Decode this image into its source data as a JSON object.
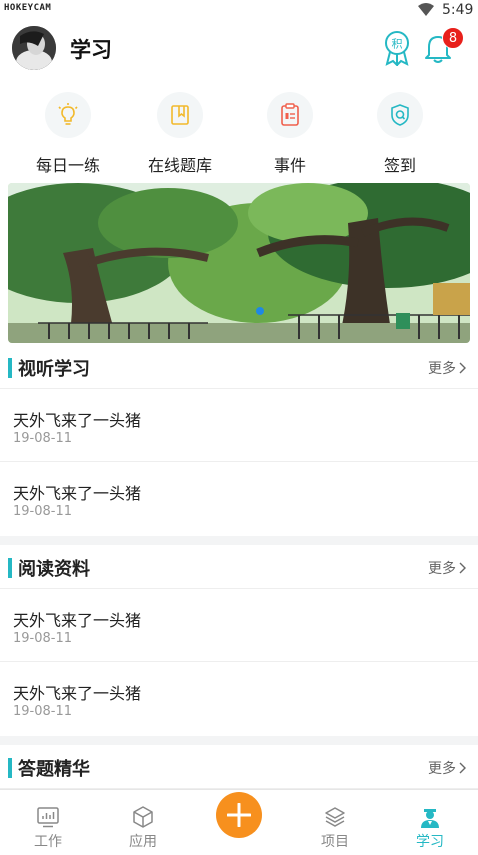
{
  "status_bar": {
    "watermark": "HOKEYCAM",
    "time": "5:49"
  },
  "header": {
    "title": "学习",
    "badge_char": "积",
    "notification_count": "8"
  },
  "quick_actions": [
    {
      "label": "每日一练",
      "icon": "lightbulb-icon",
      "color": "#f2b92b"
    },
    {
      "label": "在线题库",
      "icon": "bookmark-book-icon",
      "color": "#f2b92b"
    },
    {
      "label": "事件",
      "icon": "clipboard-icon",
      "color": "#f0604d"
    },
    {
      "label": "签到",
      "icon": "shield-check-icon",
      "color": "#25b8c4"
    }
  ],
  "sections": [
    {
      "title": "视听学习",
      "more": "更多",
      "items": [
        {
          "title": "天外飞来了一头猪",
          "date": "19-08-11"
        },
        {
          "title": "天外飞来了一头猪",
          "date": "19-08-11"
        }
      ]
    },
    {
      "title": "阅读资料",
      "more": "更多",
      "items": [
        {
          "title": "天外飞来了一头猪",
          "date": "19-08-11"
        },
        {
          "title": "天外飞来了一头猪",
          "date": "19-08-11"
        }
      ]
    },
    {
      "title": "答题精华",
      "more": "更多",
      "items": []
    }
  ],
  "bottom_nav": [
    {
      "label": "工作",
      "icon": "chart-monitor-icon"
    },
    {
      "label": "应用",
      "icon": "cube-icon"
    },
    {
      "label": "项目",
      "icon": "layers-icon"
    },
    {
      "label": "学习",
      "icon": "student-icon",
      "active": true
    }
  ],
  "colors": {
    "accent": "#25b8c4",
    "add": "#f7901e",
    "badge": "#e8201b"
  }
}
